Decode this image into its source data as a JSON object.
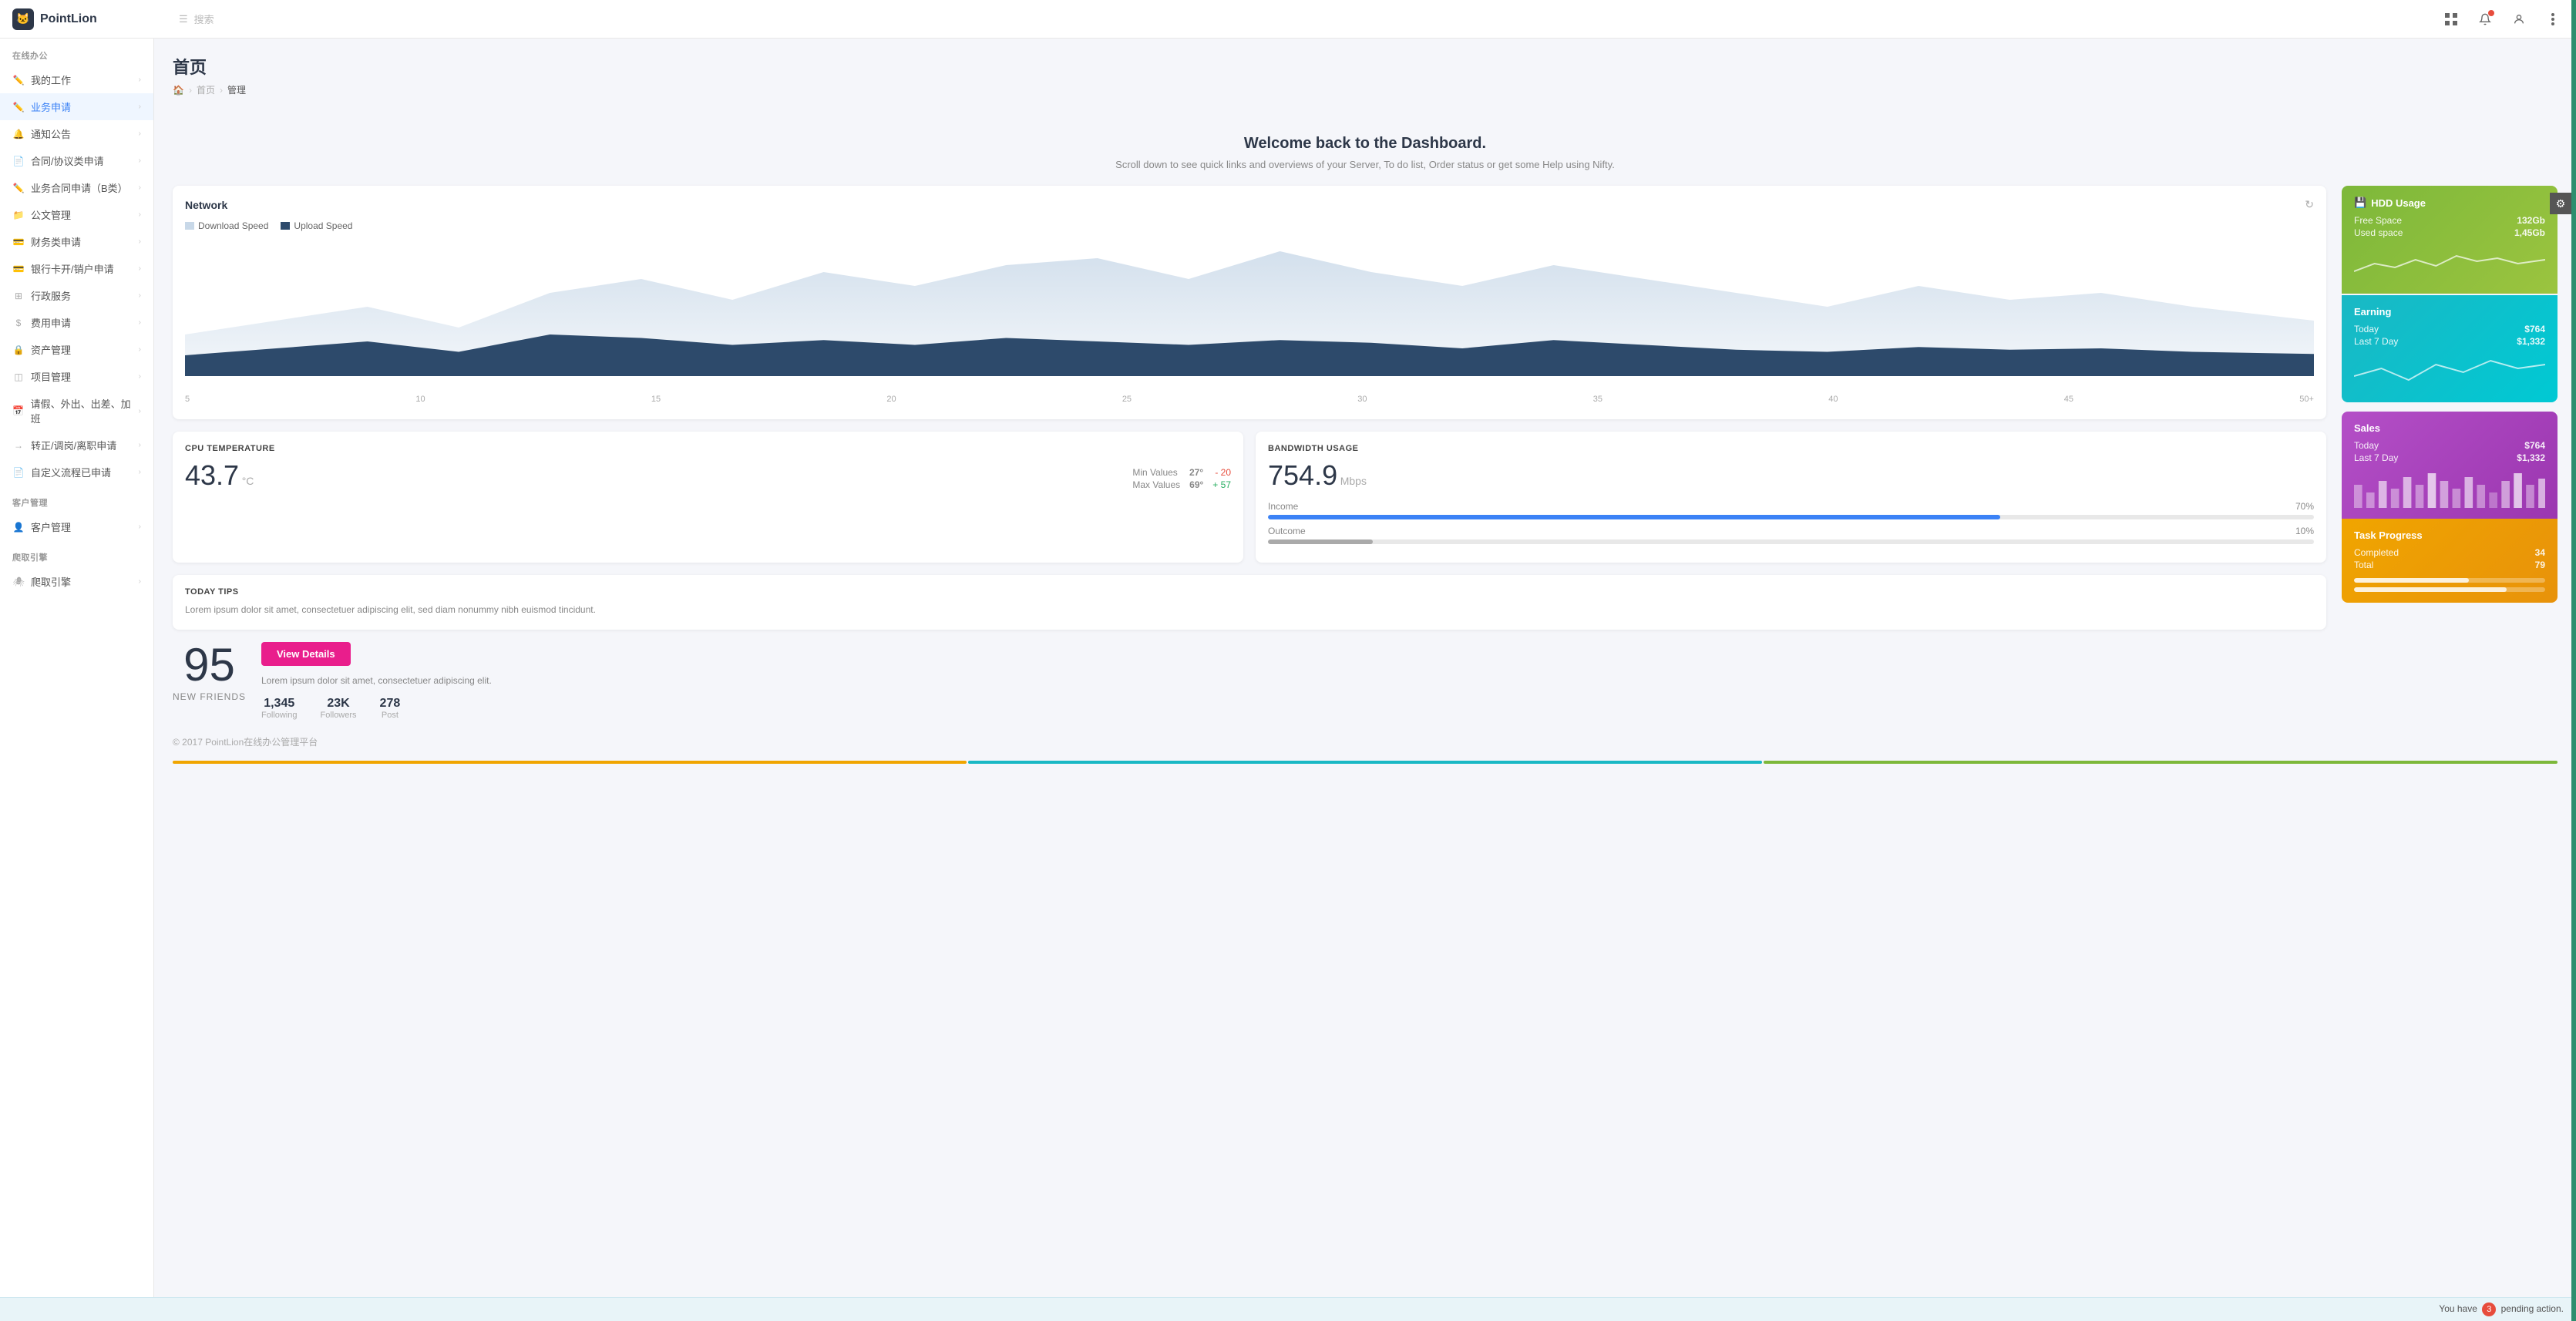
{
  "app": {
    "name": "PointLion",
    "logo_char": "🐱"
  },
  "topbar": {
    "search_placeholder": "搜索"
  },
  "sidebar": {
    "section1": "在线办公",
    "items": [
      {
        "label": "我的工作",
        "icon": "pencil",
        "active": false
      },
      {
        "label": "业务申请",
        "icon": "pencil",
        "active": true
      },
      {
        "label": "通知公告",
        "icon": "bell",
        "active": false
      },
      {
        "label": "合同/协议类申请",
        "icon": "file",
        "active": false
      },
      {
        "label": "业务合同申请（B类）",
        "icon": "pencil",
        "active": false
      },
      {
        "label": "公文管理",
        "icon": "folder",
        "active": false
      },
      {
        "label": "财务类申请",
        "icon": "credit",
        "active": false
      },
      {
        "label": "银行卡开/销户申请",
        "icon": "credit",
        "active": false
      },
      {
        "label": "行政服务",
        "icon": "grid",
        "active": false
      },
      {
        "label": "费用申请",
        "icon": "dollar",
        "active": false
      },
      {
        "label": "资产管理",
        "icon": "lock",
        "active": false
      },
      {
        "label": "项目管理",
        "icon": "layers",
        "active": false
      },
      {
        "label": "请假、外出、出差、加班",
        "icon": "calendar",
        "active": false
      },
      {
        "label": "转正/调岗/离职申请",
        "icon": "arrow",
        "active": false
      },
      {
        "label": "自定义流程已申请",
        "icon": "file",
        "active": false
      }
    ],
    "section2": "客户管理",
    "items2": [
      {
        "label": "客户管理",
        "icon": "user",
        "active": false
      }
    ],
    "section3": "爬取引擎",
    "items3": [
      {
        "label": "爬取引擎",
        "icon": "spider",
        "active": false
      }
    ]
  },
  "page": {
    "title": "首页",
    "breadcrumb": [
      "首页",
      "管理"
    ],
    "welcome_title": "Welcome back to the Dashboard.",
    "welcome_sub": "Scroll down to see quick links and overviews of your Server, To do list, Order status or get some Help using Nifty."
  },
  "network": {
    "title": "Network",
    "legend_download": "Download Speed",
    "legend_upload": "Upload Speed",
    "x_labels": [
      "5",
      "10",
      "15",
      "20",
      "25",
      "30",
      "35",
      "40",
      "45",
      "50+"
    ]
  },
  "hdd": {
    "title": "HDD Usage",
    "free_label": "Free Space",
    "free_value": "132Gb",
    "used_label": "Used space",
    "used_value": "1,45Gb"
  },
  "earning": {
    "title": "Earning",
    "today_label": "Today",
    "today_value": "$764",
    "week_label": "Last 7 Day",
    "week_value": "$1,332"
  },
  "sales": {
    "title": "Sales",
    "today_label": "Today",
    "today_value": "$764",
    "week_label": "Last 7 Day",
    "week_value": "$1,332"
  },
  "task": {
    "title": "Task Progress",
    "completed_label": "Completed",
    "completed_value": "34",
    "total_label": "Total",
    "total_value": "79",
    "bar1_pct": 60,
    "bar2_pct": 80
  },
  "cpu": {
    "label": "CPU TEMPERATURE",
    "value": "43.7",
    "unit": "°C",
    "min_label": "Min Values",
    "min_val": "27°",
    "min_diff": "- 20",
    "max_label": "Max Values",
    "max_val": "69°",
    "max_diff": "+ 57"
  },
  "bandwidth": {
    "label": "BANDWIDTH USAGE",
    "value": "754.9",
    "unit": "Mbps",
    "income_label": "Income",
    "income_pct": "70%",
    "income_bar": 70,
    "outcome_label": "Outcome",
    "outcome_pct": "10%",
    "outcome_bar": 10
  },
  "tips": {
    "label": "TODAY TIPS",
    "text": "Lorem ipsum dolor sit amet, consectetuer adipiscing elit, sed diam nonummy nibh euismod tincidunt."
  },
  "friends": {
    "number": "95",
    "label": "NEW FRIENDS"
  },
  "stats": {
    "view_details_label": "View Details",
    "lorem": "Lorem ipsum dolor sit amet, consectetuer adipiscing elit.",
    "following_num": "1,345",
    "following_label": "Following",
    "followers_num": "23K",
    "followers_label": "Followers",
    "post_num": "278",
    "post_label": "Post"
  },
  "footer": {
    "text": "© 2017 PointLion在线办公管理平台"
  },
  "pending": {
    "count": "3",
    "text": "You have",
    "action": "pending action."
  }
}
